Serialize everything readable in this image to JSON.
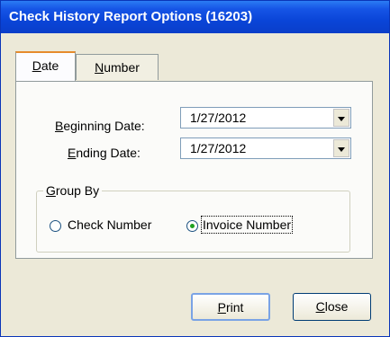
{
  "window": {
    "title": "Check History Report Options (16203)"
  },
  "tabs": [
    {
      "label": "Date",
      "accel": "D",
      "rest": "ate"
    },
    {
      "label": "Number",
      "accel": "N",
      "rest": "umber"
    }
  ],
  "fields": {
    "beginning_date": {
      "label": "Beginning Date:",
      "accel": "B",
      "rest": "eginning Date:",
      "value": "1/27/2012"
    },
    "ending_date": {
      "label": "Ending Date:",
      "accel": "E",
      "rest": "nding Date:",
      "value": "1/27/2012"
    }
  },
  "group_by": {
    "title": "Group By",
    "accel": "G",
    "rest": "roup By",
    "options": [
      {
        "label": "Check Number",
        "selected": false
      },
      {
        "label": "Invoice Number",
        "selected": true
      }
    ]
  },
  "buttons": {
    "print": {
      "label": "Print",
      "accel": "P",
      "rest": "rint"
    },
    "close": {
      "label": "Close",
      "accel": "C",
      "rest": "lose"
    }
  },
  "colors": {
    "title_bar": "#0a45d8",
    "dialog_bg": "#ece9d8",
    "panel_bg": "#fbfbf9",
    "tab_highlight": "#e68b2c",
    "radio_dot": "#21a121"
  }
}
